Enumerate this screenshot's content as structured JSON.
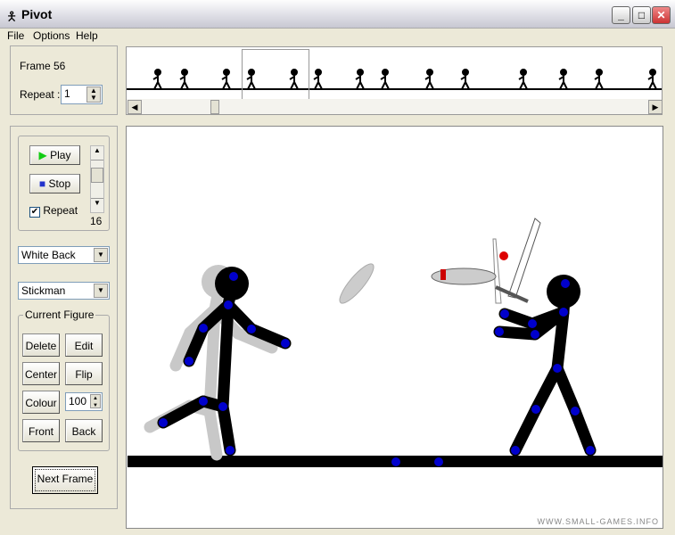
{
  "window": {
    "title": "Pivot"
  },
  "menu": [
    "File",
    "Options",
    "Help"
  ],
  "frame": {
    "label": "Frame 56",
    "repeat_label": "Repeat :",
    "repeat_value": "1"
  },
  "playback": {
    "play": "Play",
    "stop": "Stop",
    "repeat_label": "Repeat",
    "repeat_checked": true,
    "speed": "16"
  },
  "background_select": "White Back",
  "figure_select": "Stickman",
  "current_figure": {
    "title": "Current Figure",
    "delete": "Delete",
    "edit": "Edit",
    "center": "Center",
    "flip": "Flip",
    "colour": "Colour",
    "colour_value": "100",
    "front": "Front",
    "back": "Back"
  },
  "next_frame": "Next Frame",
  "watermark": "WWW.SMALL-GAMES.INFO",
  "colors": {
    "joint": "#0000cc",
    "accent_joint": "#dd0000",
    "figure": "#000000",
    "shadow": "#c8c8c8"
  }
}
